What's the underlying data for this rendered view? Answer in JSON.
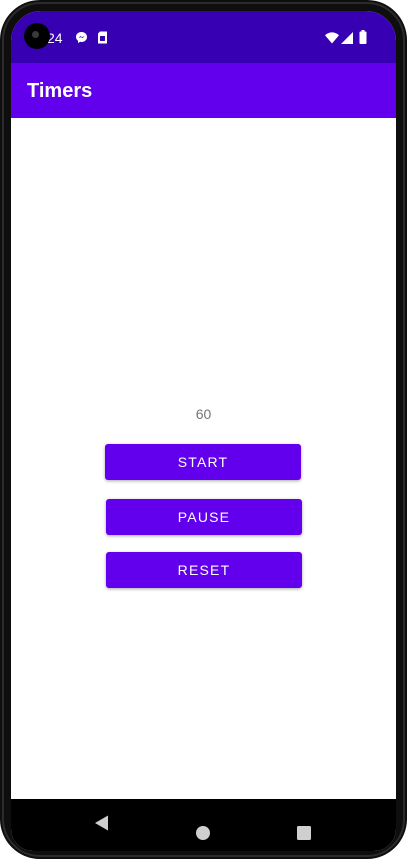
{
  "status_bar": {
    "time": "24",
    "icons": [
      "messenger-icon",
      "sim-card-icon",
      "wifi-icon",
      "cell-signal-icon",
      "battery-icon"
    ]
  },
  "app_bar": {
    "title": "Timers"
  },
  "timer": {
    "value": "60"
  },
  "buttons": {
    "start": "START",
    "pause": "PAUSE",
    "reset": "RESET"
  },
  "nav_bar": {
    "icons": [
      "back-icon",
      "home-icon",
      "recents-icon"
    ]
  },
  "colors": {
    "status_bar": "#3700b3",
    "app_bar": "#6200ee",
    "button": "#6200ee",
    "timer_text": "#757575"
  }
}
